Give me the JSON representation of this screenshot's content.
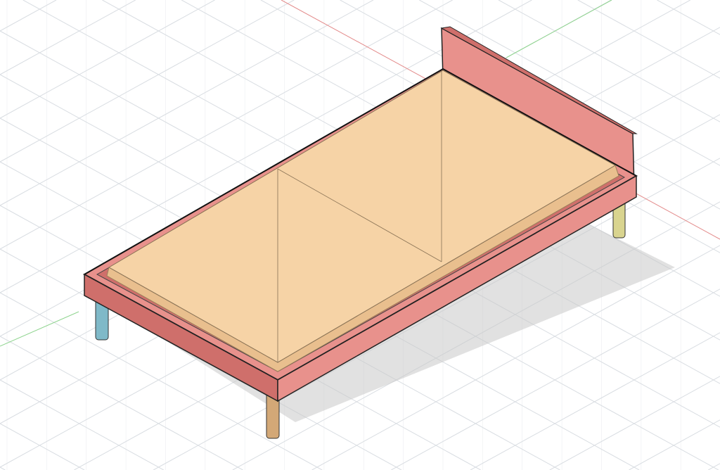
{
  "viewport": {
    "background": "#ffffff",
    "grid_color": "#d9dde2",
    "axis_x_color": "#e38a8a",
    "axis_y_color": "#8fd48f"
  },
  "model": {
    "frame_color": "#e8918c",
    "frame_dark": "#cf6f6b",
    "mattress_color": "#f6d3a6",
    "mattress_side": "#e9bf8e",
    "leg_colors": [
      "#7fb9c8",
      "#d3a877",
      "#d9d48f"
    ],
    "shadow_color": "#c9c9c9"
  }
}
